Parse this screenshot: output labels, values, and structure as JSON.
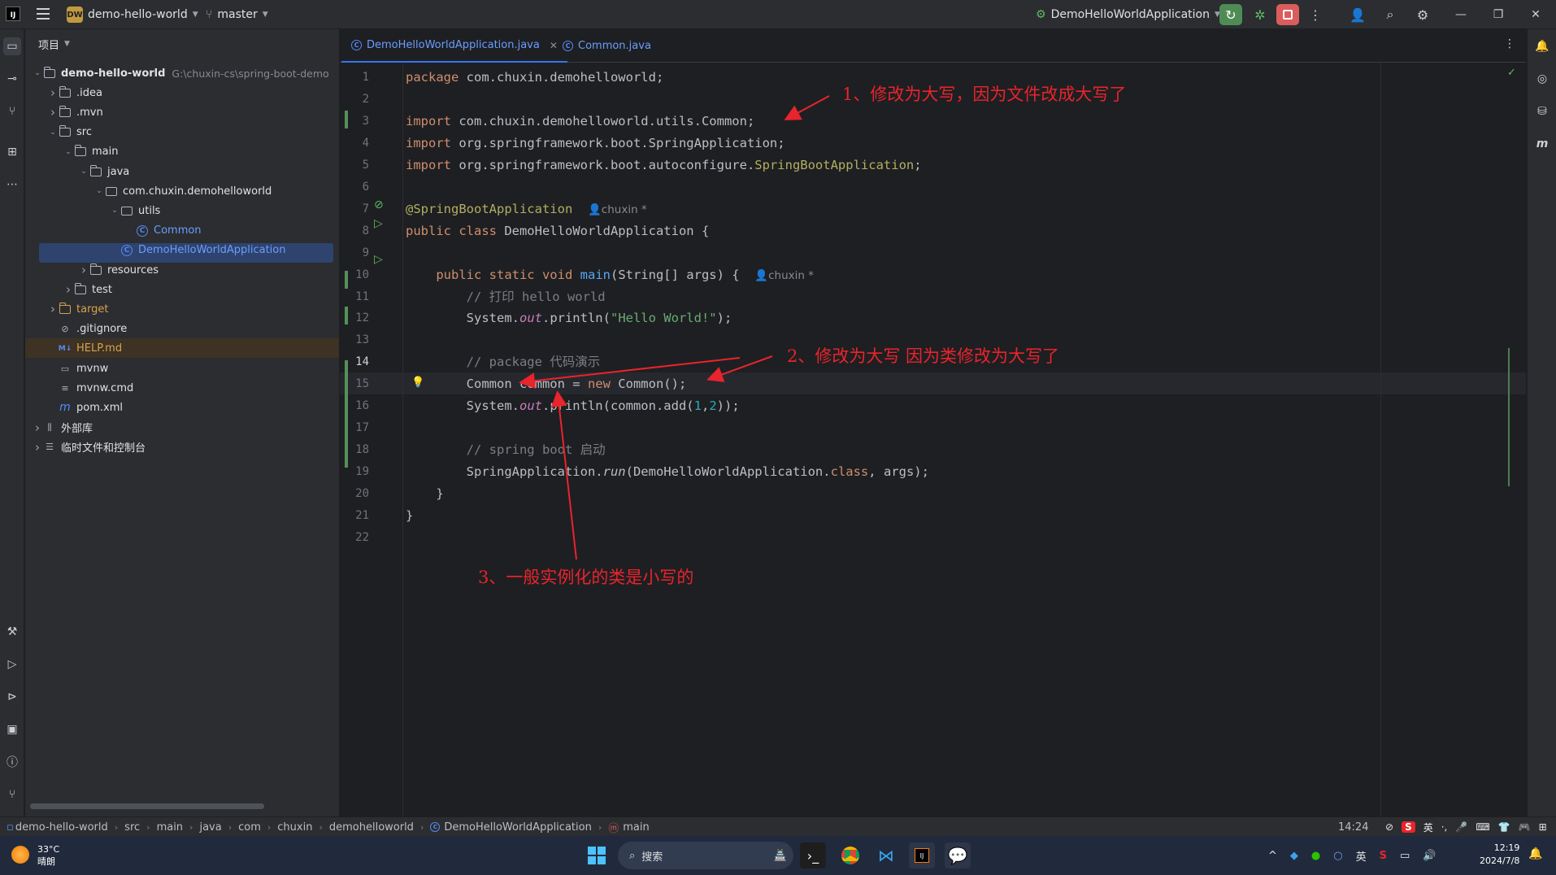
{
  "titlebar": {
    "logo": "IJ",
    "project_badge": "DW",
    "project_name": "demo-hello-world",
    "branch": "master",
    "run_config": "DemoHelloWorldApplication"
  },
  "project_panel": {
    "title": "项目",
    "root_path": "G:\\chuxin-cs\\spring-boot-demo",
    "tree": [
      {
        "label": "demo-hello-world",
        "indent": 0,
        "type": "module"
      },
      {
        "label": ".idea",
        "indent": 1,
        "type": "folder"
      },
      {
        "label": ".mvn",
        "indent": 1,
        "type": "folder"
      },
      {
        "label": "src",
        "indent": 1,
        "type": "folder"
      },
      {
        "label": "main",
        "indent": 2,
        "type": "folder"
      },
      {
        "label": "java",
        "indent": 3,
        "type": "folder"
      },
      {
        "label": "com.chuxin.demohelloworld",
        "indent": 4,
        "type": "package"
      },
      {
        "label": "utils",
        "indent": 5,
        "type": "package"
      },
      {
        "label": "Common",
        "indent": 6,
        "type": "class"
      },
      {
        "label": "DemoHelloWorldApplication",
        "indent": 5,
        "type": "class"
      },
      {
        "label": "resources",
        "indent": 3,
        "type": "folder"
      },
      {
        "label": "test",
        "indent": 2,
        "type": "folder"
      },
      {
        "label": "target",
        "indent": 1,
        "type": "folder"
      },
      {
        "label": ".gitignore",
        "indent": 1,
        "type": "file"
      },
      {
        "label": "HELP.md",
        "indent": 1,
        "type": "md"
      },
      {
        "label": "mvnw",
        "indent": 1,
        "type": "file"
      },
      {
        "label": "mvnw.cmd",
        "indent": 1,
        "type": "file"
      },
      {
        "label": "pom.xml",
        "indent": 1,
        "type": "maven"
      },
      {
        "label": "外部库",
        "indent": 0,
        "type": "lib"
      },
      {
        "label": "临时文件和控制台",
        "indent": 0,
        "type": "scratch"
      }
    ]
  },
  "tabs": [
    {
      "label": "DemoHelloWorldApplication.java",
      "active": true
    },
    {
      "label": "Common.java",
      "active": false
    }
  ],
  "code": {
    "line_numbers": [
      "1",
      "2",
      "3",
      "4",
      "5",
      "6",
      "7",
      "8",
      "9",
      "10",
      "11",
      "12",
      "13",
      "14",
      "15",
      "16",
      "17",
      "18",
      "19",
      "20",
      "21",
      "22"
    ],
    "l1_kw": "package",
    "l1_rest": " com.chuxin.demohelloworld;",
    "l3_kw": "import",
    "l3_rest": " com.chuxin.demohelloworld.utils.Common;",
    "l4_kw": "import",
    "l4_rest": " org.springframework.boot.SpringApplication;",
    "l5_kw": "import",
    "l5_rest": " org.springframework.boot.autoconfigure.",
    "l5_an": "SpringBootApplication",
    "l5_end": ";",
    "l7_an": "@SpringBootApplication",
    "author": "chuxin *",
    "l8_kw": "public class",
    "l8_rest": " DemoHelloWorldApplication {",
    "l10_kw": "public static void",
    "l10_fn": "main",
    "l10_rest": "(String[] args) {",
    "l11_cm": "// 打印 hello world",
    "l12_a": "System.",
    "l12_it": "out",
    "l12_b": ".println(",
    "l12_str": "\"Hello World!\"",
    "l12_c": ");",
    "l14_cm": "// package 代码演示",
    "l15_a": "Common common = ",
    "l15_kw": "new",
    "l15_b": " Common();",
    "l16_a": "System.",
    "l16_it": "out",
    "l16_b": ".println(common.add(",
    "l16_n1": "1",
    "l16_comma": ",",
    "l16_n2": "2",
    "l16_c": "));",
    "l18_cm": "// spring boot 启动",
    "l19_a": "SpringApplication.",
    "l19_it": "run",
    "l19_b": "(DemoHelloWorldApplication.",
    "l19_kw": "class",
    "l19_c": ", args);",
    "l20": "}",
    "l21": "}"
  },
  "annotations": {
    "a1": "1、修改为大写，因为文件改成大写了",
    "a2": "2、修改为大写  因为类修改为大写了",
    "a3": "3、一般实例化的类是小写的",
    "color": "#e8242c"
  },
  "statusbar": {
    "breadcrumbs": [
      "demo-hello-world",
      "src",
      "main",
      "java",
      "com",
      "chuxin",
      "demohelloworld",
      "DemoHelloWorldApplication",
      "main"
    ],
    "cursor": "14:24"
  },
  "taskbar": {
    "temperature": "33°C",
    "weather": "晴朗",
    "search": "搜索",
    "ime": "英",
    "time": "12:19",
    "date": "2024/7/8"
  }
}
